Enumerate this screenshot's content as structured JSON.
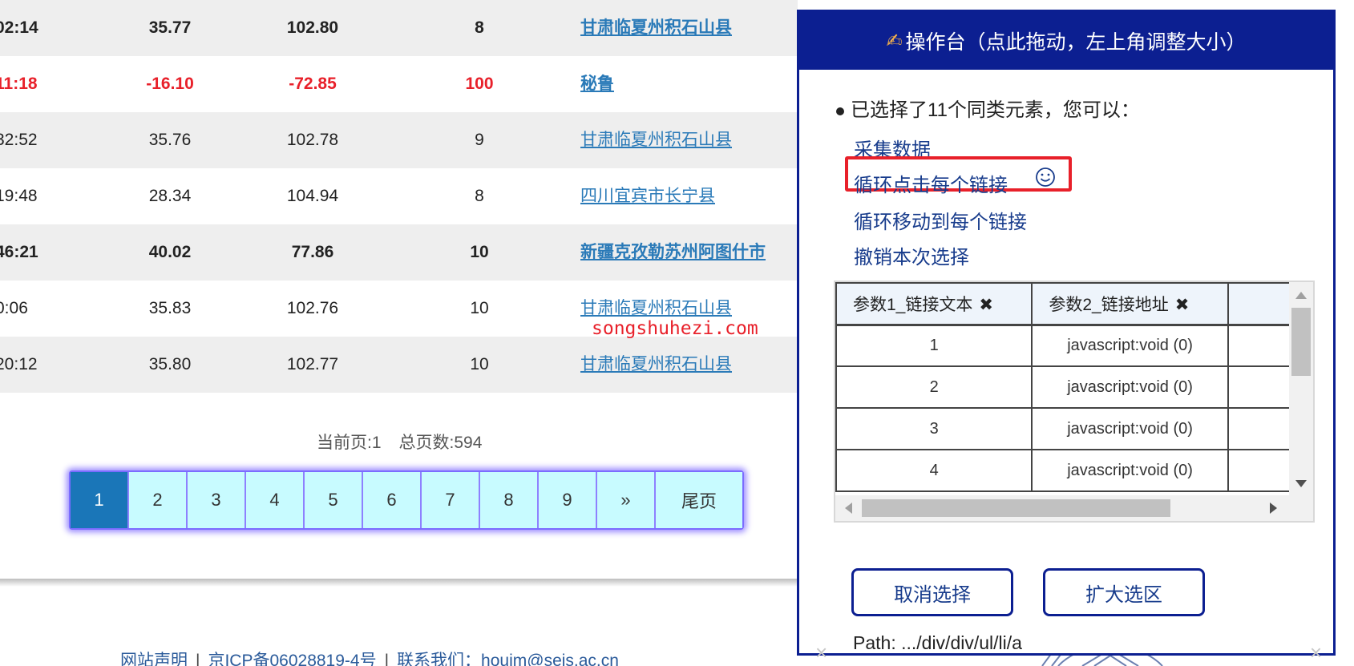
{
  "quakes": [
    {
      "time": "02:14",
      "lat": "35.77",
      "lon": "102.80",
      "depth": "8",
      "location": "甘肃临夏州积石山县",
      "style": "alt bold"
    },
    {
      "time": "11:18",
      "lat": "-16.10",
      "lon": "-72.85",
      "depth": "100",
      "location": "秘鲁",
      "style": "bold red"
    },
    {
      "time": "32:52",
      "lat": "35.76",
      "lon": "102.78",
      "depth": "9",
      "location": "甘肃临夏州积石山县",
      "style": "alt"
    },
    {
      "time": "19:48",
      "lat": "28.34",
      "lon": "104.94",
      "depth": "8",
      "location": "四川宜宾市长宁县",
      "style": ""
    },
    {
      "time": "46:21",
      "lat": "40.02",
      "lon": "77.86",
      "depth": "10",
      "location": "新疆克孜勒苏州阿图什市",
      "style": "alt bold"
    },
    {
      "time": "0:06",
      "lat": "35.83",
      "lon": "102.76",
      "depth": "10",
      "location": "甘肃临夏州积石山县",
      "style": ""
    },
    {
      "time": "20:12",
      "lat": "35.80",
      "lon": "102.77",
      "depth": "10",
      "location": "甘肃临夏州积石山县",
      "style": "alt"
    }
  ],
  "pager_info": {
    "current": "当前页:1",
    "total": "总页数:594"
  },
  "pager": [
    "1",
    "2",
    "3",
    "4",
    "5",
    "6",
    "7",
    "8",
    "9",
    "»",
    "尾页"
  ],
  "footer": {
    "statement": "网站声明",
    "icp": "京ICP备06028819-4号",
    "contact": "联系我们：houjm@seis.ac.cn",
    "sep": "|"
  },
  "watermark": "songshuhezi.com",
  "panel": {
    "title": "操作台（点此拖动，左上角调整大小）",
    "hand_icon": "✍",
    "selection_info": "已选择了11个同类元素，您可以：",
    "actions": {
      "collect": "采集数据",
      "loop_click": "循环点击每个链接",
      "loop_move": "循环移动到每个链接",
      "undo": "撤销本次选择"
    },
    "columns": [
      "参数1_链接文本",
      "参数2_链接地址"
    ],
    "column_remove": "✖",
    "rows": [
      {
        "text": "1",
        "href": "javascript:void (0)"
      },
      {
        "text": "2",
        "href": "javascript:void (0)"
      },
      {
        "text": "3",
        "href": "javascript:void (0)"
      },
      {
        "text": "4",
        "href": "javascript:void (0)"
      }
    ],
    "cancel_button": "取消选择",
    "expand_button": "扩大选区",
    "path": "Path: .../div/div/ul/li/a",
    "close_glyph": "×"
  },
  "colors": {
    "panel_blue": "#0c1f91",
    "highlight_red": "#e8202a",
    "pager_active": "#1a76b8",
    "pager_bg": "#c8fbff",
    "link_blue": "#2a7ab8"
  }
}
